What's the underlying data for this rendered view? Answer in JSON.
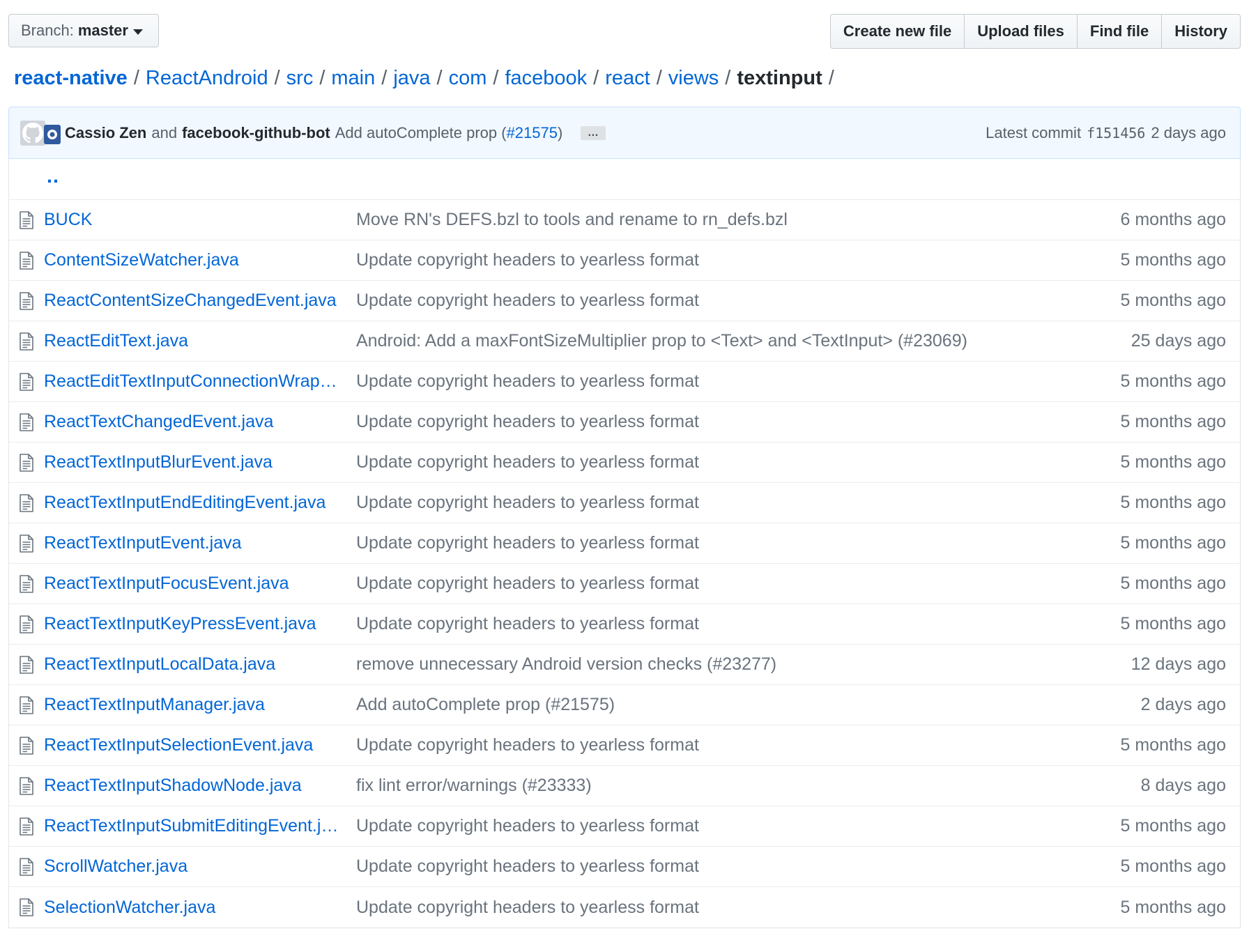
{
  "toolbar": {
    "branch_prefix": "Branch:",
    "branch_name": "master",
    "buttons": [
      "Create new file",
      "Upload files",
      "Find file",
      "History"
    ]
  },
  "breadcrumb": {
    "root": "react-native",
    "parts": [
      "ReactAndroid",
      "src",
      "main",
      "java",
      "com",
      "facebook",
      "react",
      "views"
    ],
    "current": "textinput",
    "separator": "/"
  },
  "commit": {
    "author1": "Cassio Zen",
    "and": "and",
    "author2": "facebook-github-bot",
    "message": "Add autoComplete prop (",
    "pr": "#21575",
    "message_end": ")",
    "ellipsis": "…",
    "latest_label": "Latest commit",
    "sha": "f151456",
    "age": "2 days ago"
  },
  "parent_link": "..",
  "files": [
    {
      "name": "BUCK",
      "message": "Move RN's DEFS.bzl to tools and rename to rn_defs.bzl",
      "age": "6 months ago"
    },
    {
      "name": "ContentSizeWatcher.java",
      "message": "Update copyright headers to yearless format",
      "age": "5 months ago"
    },
    {
      "name": "ReactContentSizeChangedEvent.java",
      "message": "Update copyright headers to yearless format",
      "age": "5 months ago"
    },
    {
      "name": "ReactEditText.java",
      "message": "Android: Add a maxFontSizeMultiplier prop to <Text> and <TextInput> (#23069)",
      "age": "25 days ago"
    },
    {
      "name": "ReactEditTextInputConnectionWrapper.java",
      "message": "Update copyright headers to yearless format",
      "age": "5 months ago"
    },
    {
      "name": "ReactTextChangedEvent.java",
      "message": "Update copyright headers to yearless format",
      "age": "5 months ago"
    },
    {
      "name": "ReactTextInputBlurEvent.java",
      "message": "Update copyright headers to yearless format",
      "age": "5 months ago"
    },
    {
      "name": "ReactTextInputEndEditingEvent.java",
      "message": "Update copyright headers to yearless format",
      "age": "5 months ago"
    },
    {
      "name": "ReactTextInputEvent.java",
      "message": "Update copyright headers to yearless format",
      "age": "5 months ago"
    },
    {
      "name": "ReactTextInputFocusEvent.java",
      "message": "Update copyright headers to yearless format",
      "age": "5 months ago"
    },
    {
      "name": "ReactTextInputKeyPressEvent.java",
      "message": "Update copyright headers to yearless format",
      "age": "5 months ago"
    },
    {
      "name": "ReactTextInputLocalData.java",
      "message": "remove unnecessary Android version checks (#23277)",
      "age": "12 days ago"
    },
    {
      "name": "ReactTextInputManager.java",
      "message": "Add autoComplete prop (#21575)",
      "age": "2 days ago"
    },
    {
      "name": "ReactTextInputSelectionEvent.java",
      "message": "Update copyright headers to yearless format",
      "age": "5 months ago"
    },
    {
      "name": "ReactTextInputShadowNode.java",
      "message": "fix lint error/warnings (#23333)",
      "age": "8 days ago"
    },
    {
      "name": "ReactTextInputSubmitEditingEvent.java",
      "message": "Update copyright headers to yearless format",
      "age": "5 months ago"
    },
    {
      "name": "ScrollWatcher.java",
      "message": "Update copyright headers to yearless format",
      "age": "5 months ago"
    },
    {
      "name": "SelectionWatcher.java",
      "message": "Update copyright headers to yearless format",
      "age": "5 months ago"
    }
  ]
}
